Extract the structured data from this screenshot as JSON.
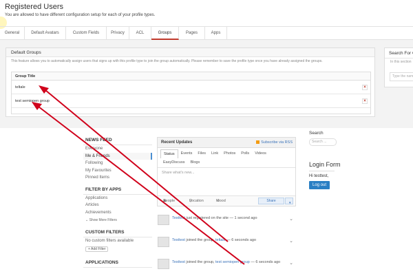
{
  "admin": {
    "title": "Registered Users",
    "subtitle": "You are allowed to have different configuration setup for each of your profile types.",
    "tabs": [
      {
        "label": "General",
        "active": false
      },
      {
        "label": "Default Avatars",
        "active": false
      },
      {
        "label": "Custom Fields",
        "active": false
      },
      {
        "label": "Privacy",
        "active": false
      },
      {
        "label": "ACL",
        "active": false
      },
      {
        "label": "Groups",
        "active": true
      },
      {
        "label": "Pages",
        "active": false
      },
      {
        "label": "Apps",
        "active": false
      }
    ],
    "default_groups": {
      "heading": "Default Groups",
      "description": "This feature allows you to automatically assign users that signs up with this profile type to join the group automatically. Please remember to save the profile type once you have already assigned the groups.",
      "column_header": "Group Title",
      "rows": [
        "teltale",
        "test semiopen group"
      ],
      "delete_glyph": "×"
    },
    "search_panel": {
      "heading": "Search For G",
      "hint": "In this section",
      "placeholder": "Type the nam"
    }
  },
  "site": {
    "news_feed": {
      "heading": "NEWS FEED",
      "items": [
        {
          "label": "Everyone",
          "active": false
        },
        {
          "label": "Me & Friends",
          "active": true
        },
        {
          "label": "Following",
          "active": false
        },
        {
          "label": "My Favourites",
          "active": false
        },
        {
          "label": "Pinned Items",
          "active": false
        }
      ]
    },
    "filter_by_apps": {
      "heading": "FILTER BY APPS",
      "items": [
        "Applications",
        "Articles",
        "Achievements"
      ],
      "show_more": "Show More Filters"
    },
    "custom_filters": {
      "heading": "CUSTOM FILTERS",
      "empty": "No custom filters available",
      "add": "+ Add Filter"
    },
    "applications": {
      "heading": "APPLICATIONS"
    },
    "stream": {
      "heading": "Recent Updates",
      "subscribe": "Subscribe via RSS",
      "tabs": [
        {
          "label": "Status",
          "active": true
        },
        {
          "label": "Events",
          "active": false
        },
        {
          "label": "Files",
          "active": false
        },
        {
          "label": "Link",
          "active": false
        },
        {
          "label": "Photos",
          "active": false
        },
        {
          "label": "Polls",
          "active": false
        },
        {
          "label": "Videos",
          "active": false
        },
        {
          "label": "EasyDiscuss",
          "active": false
        },
        {
          "label": "Blogs",
          "active": false
        }
      ],
      "placeholder": "Share what's new...",
      "people": "People",
      "location": "Location",
      "mood": "Mood",
      "share": "Share",
      "share_caret": "▾"
    },
    "feed": [
      {
        "user": "Testtest",
        "text": "just registered on the site",
        "sep": " — ",
        "time": "1 second ago",
        "group": ""
      },
      {
        "user": "Testtest",
        "text": "joined the group,",
        "sep": " — ",
        "time": "6 seconds ago",
        "group": "teltale"
      },
      {
        "user": "Testtest",
        "text": "joined the group,",
        "sep": " — ",
        "time": "6 seconds ago",
        "group": "test semiopen group"
      }
    ],
    "right": {
      "search_heading": "Search",
      "search_placeholder": "Search ...",
      "login_heading": "Login Form",
      "greeting": "Hi testtest,",
      "logout": "Log out"
    }
  },
  "colors": {
    "arrow": "#d0021b",
    "link": "#3b73b9",
    "active_tab": "#c0392b"
  },
  "icons": [
    "rss-icon",
    "delete-icon",
    "chevron-down-icon",
    "people-icon",
    "location-icon",
    "mood-icon",
    "arrow-annotation"
  ]
}
